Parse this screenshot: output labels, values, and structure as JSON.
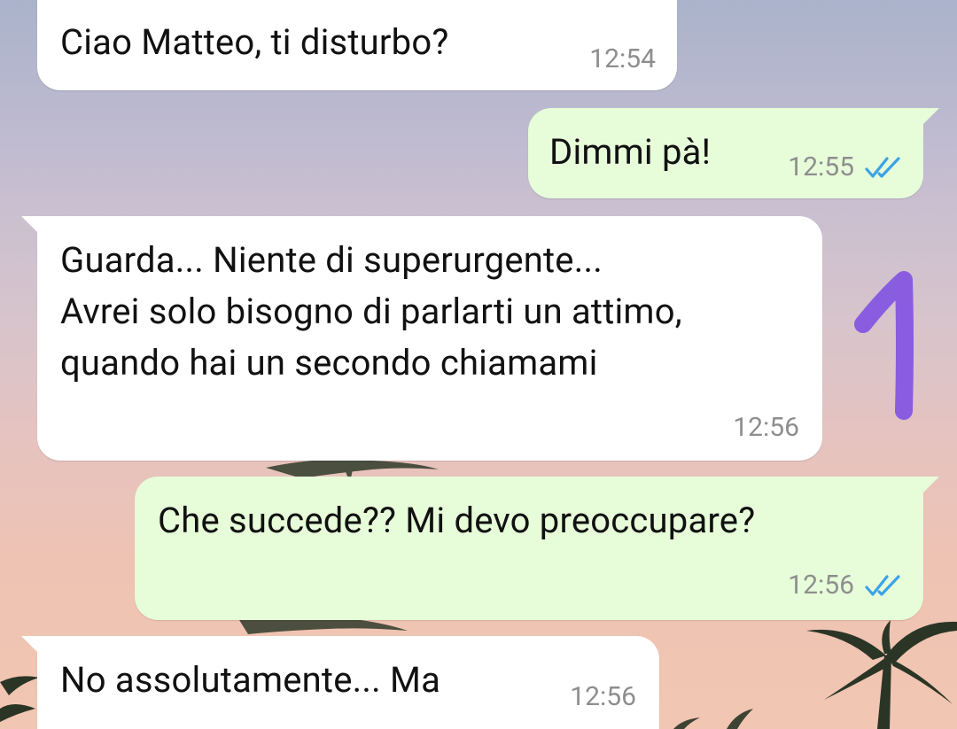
{
  "colors": {
    "incoming_bubble": "#ffffff",
    "outgoing_bubble": "#e7fcd9",
    "timestamp": "#8e8e8e",
    "read_ticks": "#3ba3e8",
    "annotation": "#8a5ce0"
  },
  "messages": [
    {
      "direction": "incoming",
      "text": "Ciao Matteo, ti disturbo?",
      "time": "12:54"
    },
    {
      "direction": "outgoing",
      "text": "Dimmi pà!",
      "time": "12:55",
      "status_icon": "double-check-icon"
    },
    {
      "direction": "incoming",
      "lines": [
        "Guarda... Niente di superurgente...",
        "Avrei solo bisogno di parlarti un attimo,",
        "quando hai un secondo chiamami"
      ],
      "time": "12:56"
    },
    {
      "direction": "outgoing",
      "text": "Che succede?? Mi devo preoccupare?",
      "time": "12:56",
      "status_icon": "double-check-icon"
    },
    {
      "direction": "incoming",
      "text": "No assolutamente... Ma",
      "time": "12:56"
    }
  ],
  "annotation": {
    "text": "1"
  }
}
